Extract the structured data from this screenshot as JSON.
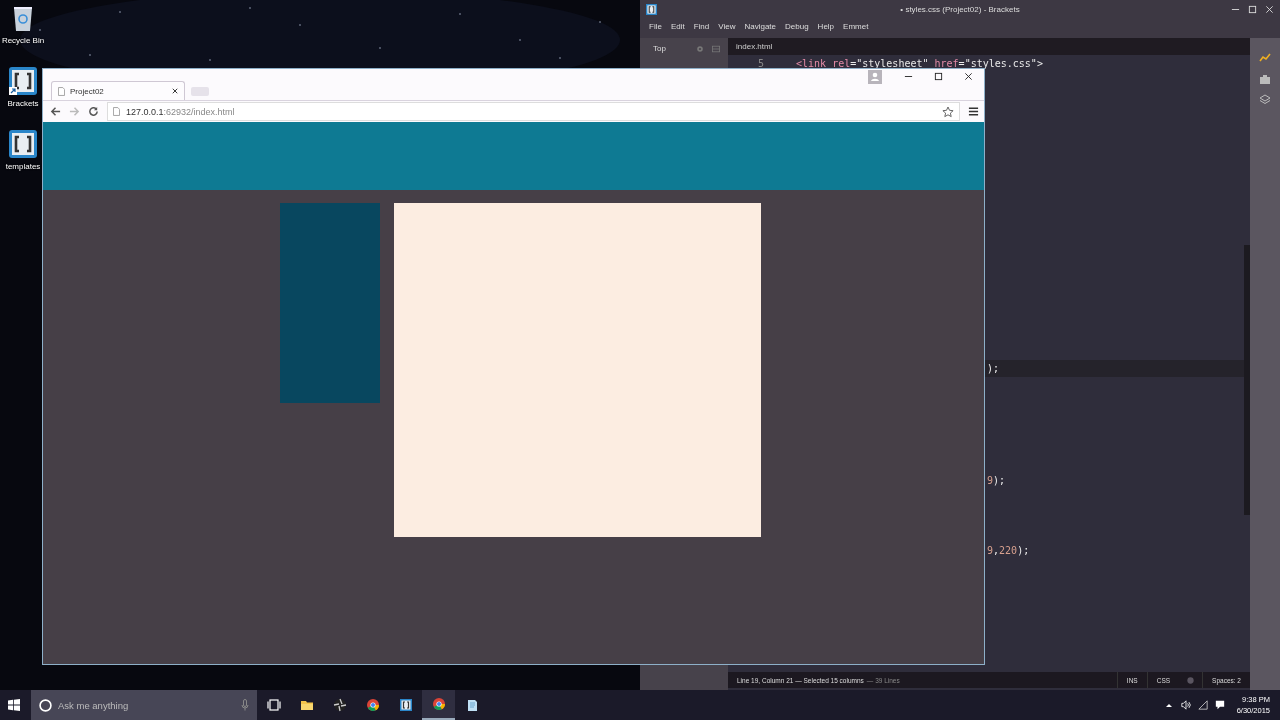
{
  "desktop": {
    "icons": [
      {
        "label": "Recycle Bin",
        "kind": "bin"
      },
      {
        "label": "Brackets",
        "kind": "brackets",
        "shortcut": true
      },
      {
        "label": "templates",
        "kind": "brackets",
        "shortcut": false
      }
    ]
  },
  "editor": {
    "title": "• styles.css (Project02) - Brackets",
    "menu": [
      "File",
      "Edit",
      "Find",
      "View",
      "Navigate",
      "Debug",
      "Help",
      "Emmet"
    ],
    "sidebar": {
      "title": "Top"
    },
    "tab": "index.html",
    "lines": [
      {
        "number": "5",
        "segments": [
          {
            "text": "<link",
            "kind": "tag"
          },
          {
            "text": " rel",
            "kind": "attr"
          },
          {
            "text": "=",
            "kind": "punct"
          },
          {
            "text": "\"stylesheet\"",
            "kind": "string"
          },
          {
            "text": " href",
            "kind": "attr"
          },
          {
            "text": "=",
            "kind": "punct"
          },
          {
            "text": "\"styles.css\"",
            "kind": "string"
          },
          {
            "text": ">",
            "kind": "punct"
          }
        ]
      }
    ],
    "fragments": [
      {
        "segments": [
          {
            "text": ");",
            "kind": "punct"
          }
        ],
        "highlighted": true
      },
      {
        "segments": [
          {
            "text": "9",
            "kind": "number"
          },
          {
            "text": ");",
            "kind": "punct"
          }
        ],
        "highlighted": false
      },
      {
        "segments": [
          {
            "text": "9",
            "kind": "number"
          },
          {
            "text": ",",
            "kind": "punct"
          },
          {
            "text": "220",
            "kind": "number"
          },
          {
            "text": ");",
            "kind": "punct"
          }
        ],
        "highlighted": false
      }
    ],
    "status": {
      "position": "Line 19, Column 21 — Selected 15 columns",
      "lines": "— 39 Lines",
      "mode": "INS",
      "language": "CSS",
      "spaces": "Spaces: 2"
    }
  },
  "browser": {
    "tab": "Project02",
    "url_host": "127.0.0.1",
    "url_rest": ":62932/index.html",
    "page": {
      "boxes": [
        {
          "color": "#08475f"
        },
        {
          "color": "#fcede1"
        }
      ]
    }
  },
  "taskbar": {
    "search": {
      "placeholder": "Ask me anything"
    },
    "apps": [
      {
        "kind": "taskview"
      },
      {
        "kind": "folder"
      },
      {
        "kind": "media"
      },
      {
        "kind": "chrome",
        "active": false
      },
      {
        "kind": "brackets",
        "active": false
      },
      {
        "kind": "chrome",
        "active": true
      },
      {
        "kind": "notepad",
        "active": false
      }
    ],
    "time": "9:38 PM",
    "date": "6/30/2015"
  }
}
